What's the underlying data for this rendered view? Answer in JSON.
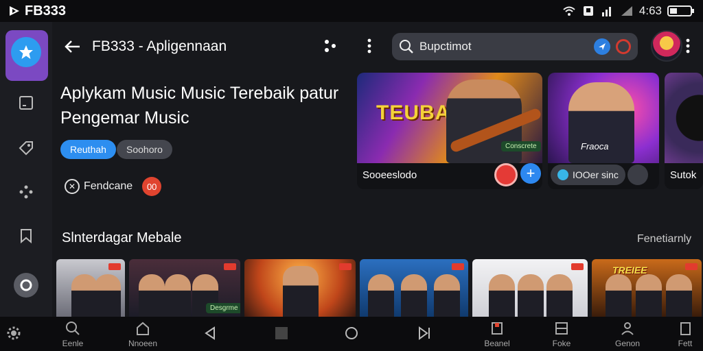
{
  "status_bar": {
    "app_name": "FB333",
    "time": "4:63",
    "icons": [
      "wifi-icon",
      "notification-icon",
      "signal-bars-icon",
      "battery-icon"
    ]
  },
  "header": {
    "title": "FB333 - Apligennaan",
    "search": {
      "value": "Bupctimot",
      "placeholder": ""
    }
  },
  "hero": {
    "title": "Aplykam Music Music Terebaik patur Pengemar Music",
    "chips": [
      "Reuthah",
      "Soohoro"
    ],
    "meta_label": "Fendcane",
    "meta_count": "00"
  },
  "featured": {
    "card1": {
      "label": "Sooeeslodo",
      "headline": "TEUBAN",
      "tag": "Conscrete"
    },
    "card2": {
      "pill_label": "IOOer sinc",
      "brand": "Fraoca"
    },
    "card3": {
      "label": "Sutok"
    }
  },
  "section": {
    "title": "Slnterdagar Mebale",
    "link": "Fenetiarnly",
    "thumb_tag": "Desgrme",
    "poster_text": "TREIEE"
  },
  "bottom_nav": {
    "items": [
      {
        "label": "",
        "icon": "gear-icon"
      },
      {
        "label": "Eenle",
        "icon": "search-icon"
      },
      {
        "label": "Nnoeen",
        "icon": "home-icon"
      },
      {
        "label": "",
        "icon": "back-triangle-icon"
      },
      {
        "label": "",
        "icon": "square-icon"
      },
      {
        "label": "",
        "icon": "circle-icon"
      },
      {
        "label": "",
        "icon": "skip-icon"
      },
      {
        "label": "Beanel",
        "icon": "library-icon"
      },
      {
        "label": "Foke",
        "icon": "box-icon"
      },
      {
        "label": "Genon",
        "icon": "person-icon"
      },
      {
        "label": "Fett",
        "icon": "copy-icon"
      }
    ]
  },
  "colors": {
    "accent": "#2d8ef0",
    "rail_active": "#7b49c2",
    "badge": "#e0442f",
    "background": "#17181c"
  }
}
